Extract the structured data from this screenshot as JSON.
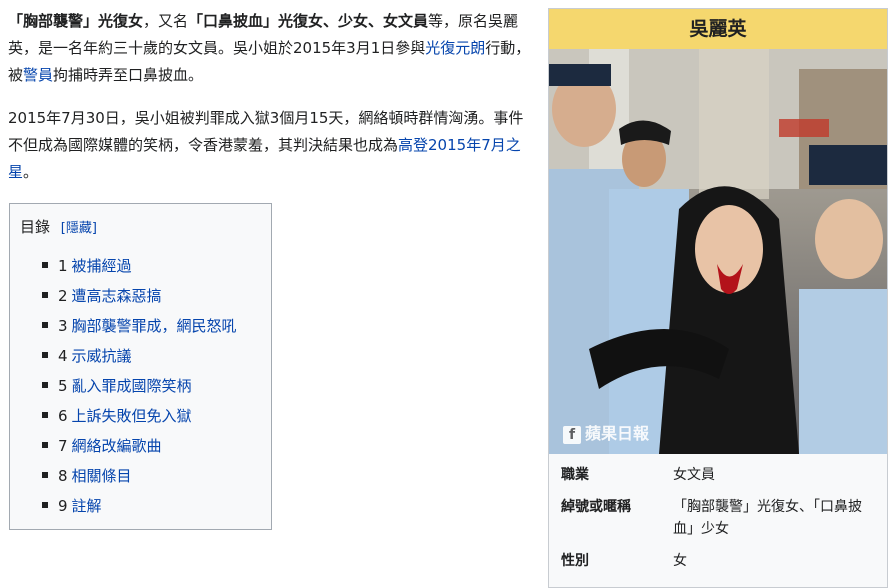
{
  "intro": {
    "p1": [
      {
        "t": "「胸部襲警」光復女",
        "style": "bold"
      },
      {
        "t": "，又名",
        "style": "text"
      },
      {
        "t": "「口鼻披血」光復女、少女、女文員",
        "style": "bold"
      },
      {
        "t": "等，原名吳麗英，是一名年約三十歲的女文員。吳小姐於2015年3月1日參與",
        "style": "text"
      },
      {
        "t": "光復元朗",
        "style": "link"
      },
      {
        "t": "行動，被",
        "style": "text"
      },
      {
        "t": "警員",
        "style": "link"
      },
      {
        "t": "拘捕時弄至口鼻披血。",
        "style": "text"
      }
    ],
    "p2": [
      {
        "t": "2015年7月30日，吳小姐被判罪成入獄3個月15天，網絡頓時群情洶湧。事件不但成為國際媒體的笑柄，令香港蒙羞，其判決結果也成為",
        "style": "text"
      },
      {
        "t": "高登2015年7月之星",
        "style": "link"
      },
      {
        "t": "。",
        "style": "text"
      }
    ]
  },
  "toc": {
    "title": "目錄",
    "hide_label": "[隱藏]",
    "items": [
      {
        "num": "1",
        "label": "被捕經過"
      },
      {
        "num": "2",
        "label": "遭高志森惡搞"
      },
      {
        "num": "3",
        "label": "胸部襲警罪成，網民怒吼"
      },
      {
        "num": "4",
        "label": "示威抗議"
      },
      {
        "num": "5",
        "label": "亂入罪成國際笑柄"
      },
      {
        "num": "6",
        "label": "上訴失敗但免入獄"
      },
      {
        "num": "7",
        "label": "網絡改編歌曲"
      },
      {
        "num": "8",
        "label": "相關條目"
      },
      {
        "num": "9",
        "label": "註解"
      }
    ]
  },
  "infobox": {
    "title": "吳麗英",
    "photo_caption": "蘋果日報",
    "rows": [
      {
        "label": "職業",
        "value": "女文員"
      },
      {
        "label": "綽號或暱稱",
        "value": "「胸部襲警」光復女、「口鼻披血」少女"
      },
      {
        "label": "性別",
        "value": "女"
      }
    ]
  }
}
